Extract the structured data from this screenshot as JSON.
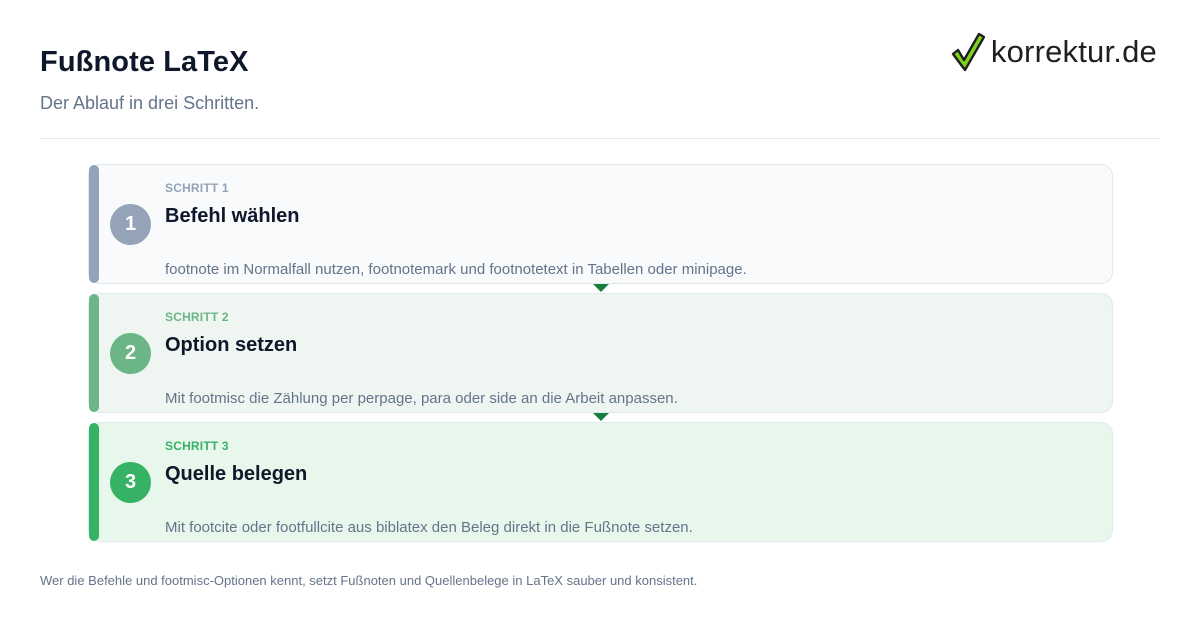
{
  "header": {
    "title": "Fußnote LaTeX",
    "subtitle": "Der Ablauf in drei Schritten."
  },
  "logo": {
    "text": "korrektur.de",
    "icon": "checkmark-icon",
    "check_color": "#7ed321"
  },
  "steps": [
    {
      "kicker": "SCHRITT 1",
      "number": "1",
      "title": "Befehl wählen",
      "description": "footnote im Normalfall nutzen, footnotemark und footnotetext in Tabellen oder minipage.",
      "accent": "#94a3b8",
      "background": "#f8fafc"
    },
    {
      "kicker": "SCHRITT 2",
      "number": "2",
      "title": "Option setzen",
      "description": "Mit footmisc die Zählung per perpage, para oder side an die Arbeit anpassen.",
      "accent": "#6bb586",
      "background": "#eff6f1"
    },
    {
      "kicker": "SCHRITT 3",
      "number": "3",
      "title": "Quelle belegen",
      "description": "Mit footcite oder footfullcite aus biblatex den Beleg direkt in die Fußnote setzen.",
      "accent": "#35b264",
      "background": "#e7f7ec"
    }
  ],
  "connector_color": "#15803d",
  "footer": {
    "text": "Wer die Befehle und footmisc-Optionen kennt, setzt Fußnoten und Quellenbelege in LaTeX sauber und konsistent."
  }
}
